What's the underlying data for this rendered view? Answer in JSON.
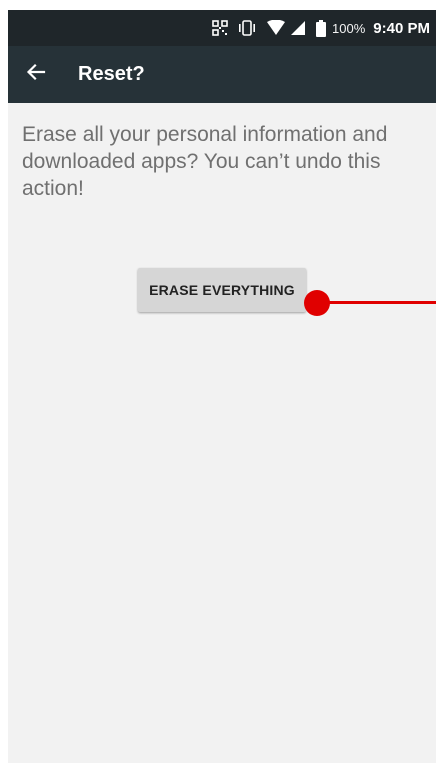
{
  "status_bar": {
    "icons": [
      "qr-scanner-icon",
      "vibrate-icon",
      "wifi-icon",
      "cell-signal-icon",
      "battery-icon"
    ],
    "battery_percent": "100%",
    "time": "9:40 PM"
  },
  "app_bar": {
    "back_icon": "arrow-back-icon",
    "title": "Reset?"
  },
  "main": {
    "message": "Erase all your personal information and downloaded apps? You can’t undo this action!",
    "erase_button_label": "ERASE EVERYTHING"
  },
  "colors": {
    "status_bar_bg": "#1f262a",
    "app_bar_bg": "#263238",
    "background": "#f2f2f2",
    "button_bg": "#d6d6d6",
    "marker": "#e00000"
  }
}
